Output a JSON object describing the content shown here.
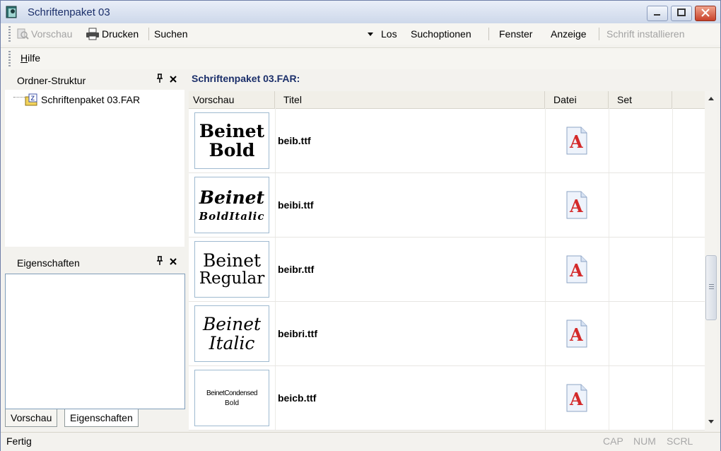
{
  "window": {
    "title": "Schriftenpaket 03"
  },
  "toolbar": {
    "vorschau": "Vorschau",
    "drucken": "Drucken",
    "suchen": "Suchen",
    "los": "Los",
    "suchoptionen": "Suchoptionen",
    "fenster": "Fenster",
    "anzeige": "Anzeige",
    "schrift_installieren": "Schrift installieren"
  },
  "menubar": {
    "hilfe_prefix": "H",
    "hilfe_rest": "ilfe"
  },
  "folder_pane": {
    "title": "Ordner-Struktur",
    "items": [
      {
        "label": "Schriftenpaket 03.FAR"
      }
    ]
  },
  "properties_pane": {
    "title": "Eigenschaften"
  },
  "bottom_tabs": [
    {
      "label": "Vorschau"
    },
    {
      "label": "Eigenschaften"
    }
  ],
  "main": {
    "title": "Schriftenpaket 03.FAR:",
    "columns": [
      "Vorschau",
      "Titel",
      "Datei",
      "Set"
    ],
    "rows": [
      {
        "preview_line1": "Beinet",
        "preview_line2": "Bold",
        "style": "bold",
        "file": "beib.ttf"
      },
      {
        "preview_line1": "Beinet",
        "preview_line2": "BoldItalic",
        "style": "bolditalic",
        "file": "beibi.ttf"
      },
      {
        "preview_line1": "Beinet",
        "preview_line2": "Regular",
        "style": "regular",
        "file": "beibr.ttf"
      },
      {
        "preview_line1": "Beinet",
        "preview_line2": "Italic",
        "style": "italic",
        "file": "beibri.ttf"
      },
      {
        "preview_line1": "BeinetCondensed",
        "preview_line2": "Bold",
        "style": "condensed",
        "file": "beicb.ttf"
      }
    ]
  },
  "status": {
    "text": "Fertig",
    "cap": "CAP",
    "num": "NUM",
    "scrl": "SCRL"
  },
  "colors": {
    "accent": "#1b2f6a",
    "file_icon_red": "#d42a2a",
    "disabled": "#a3a3a3"
  }
}
